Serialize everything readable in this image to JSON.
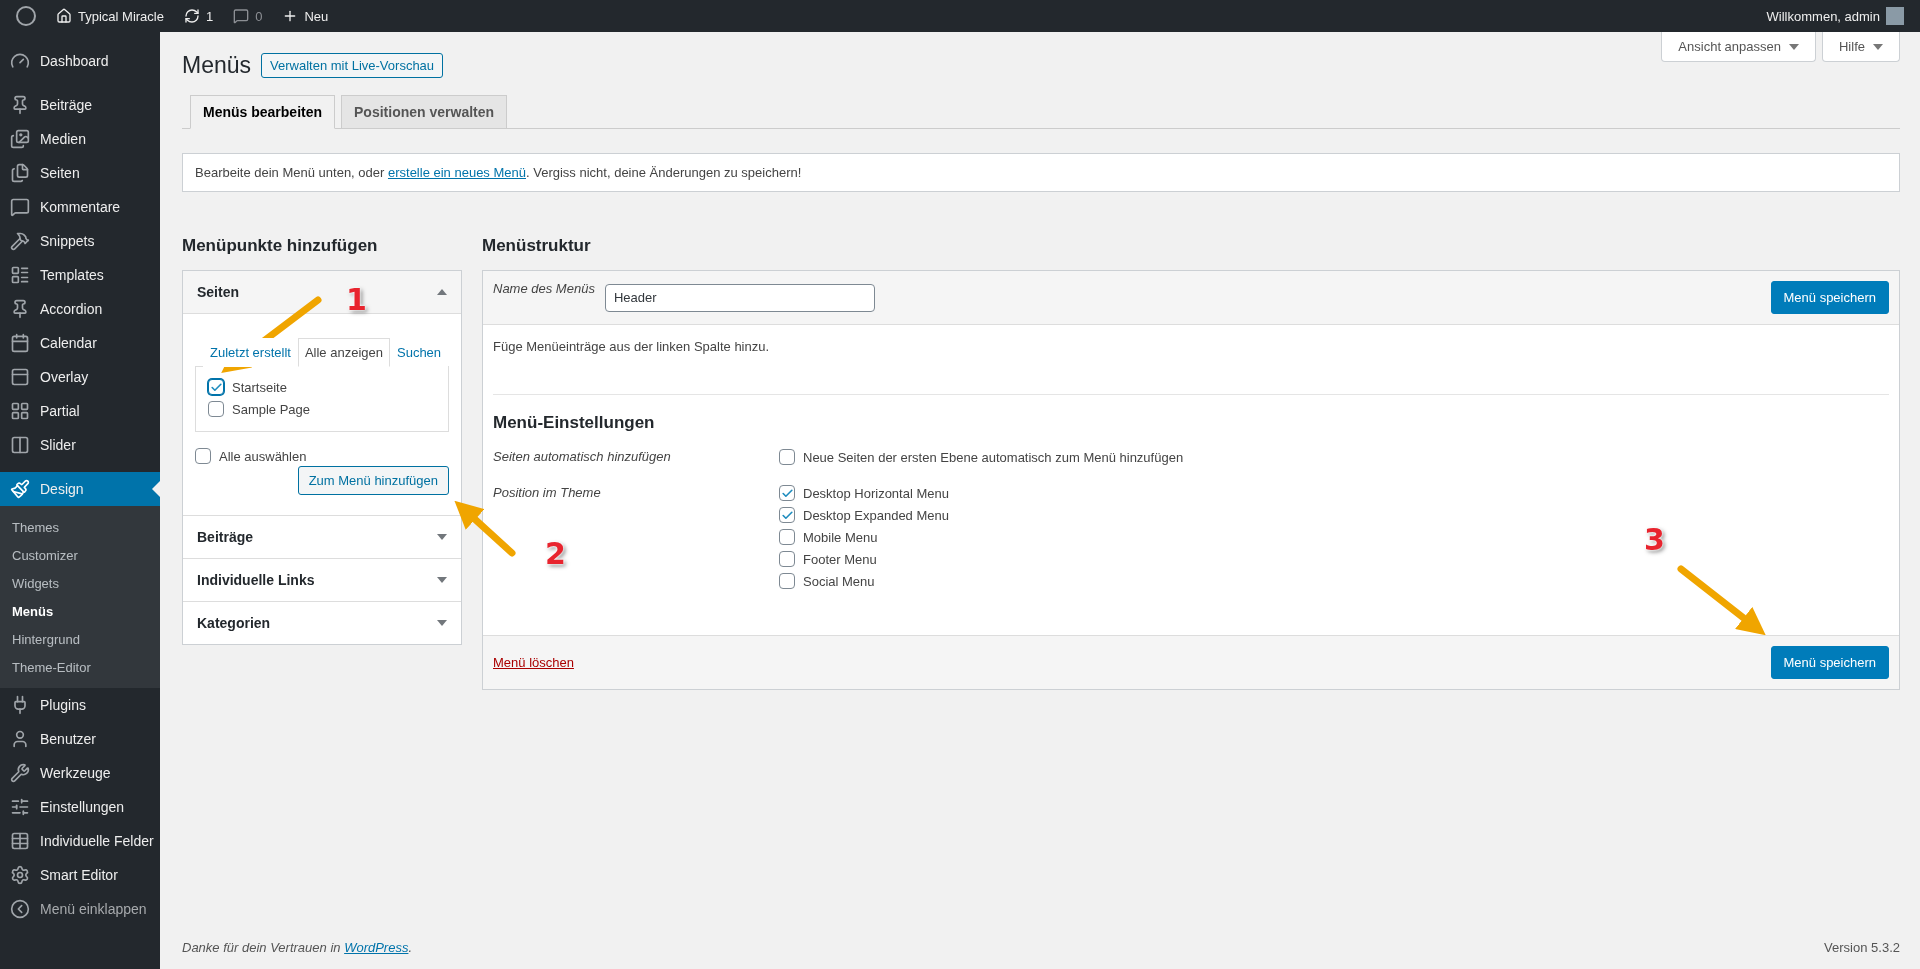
{
  "admin_bar": {
    "site": "Typical Miracle",
    "updates": "1",
    "comments": "0",
    "new": "Neu",
    "greeting": "Willkommen, admin"
  },
  "sidebar": {
    "items": [
      {
        "label": "Dashboard",
        "selected": false
      },
      {
        "label": "Beiträge",
        "selected": false
      },
      {
        "label": "Medien",
        "selected": false
      },
      {
        "label": "Seiten",
        "selected": false
      },
      {
        "label": "Kommentare",
        "selected": false
      },
      {
        "label": "Snippets",
        "selected": false
      },
      {
        "label": "Templates",
        "selected": false
      },
      {
        "label": "Accordion",
        "selected": false
      },
      {
        "label": "Calendar",
        "selected": false
      },
      {
        "label": "Overlay",
        "selected": false
      },
      {
        "label": "Partial",
        "selected": false
      },
      {
        "label": "Slider",
        "selected": false
      },
      {
        "label": "Design",
        "selected": true,
        "children": [
          {
            "label": "Themes",
            "selected": false
          },
          {
            "label": "Customizer",
            "selected": false
          },
          {
            "label": "Widgets",
            "selected": false
          },
          {
            "label": "Menüs",
            "selected": true
          },
          {
            "label": "Hintergrund",
            "selected": false
          },
          {
            "label": "Theme-Editor",
            "selected": false
          }
        ]
      },
      {
        "label": "Plugins",
        "selected": false
      },
      {
        "label": "Benutzer",
        "selected": false
      },
      {
        "label": "Werkzeuge",
        "selected": false
      },
      {
        "label": "Einstellungen",
        "selected": false
      },
      {
        "label": "Individuelle Felder",
        "selected": false
      },
      {
        "label": "Smart Editor",
        "selected": false
      },
      {
        "label": "Menü einklappen",
        "selected": false,
        "kind": "collapse"
      }
    ]
  },
  "screen_meta": [
    "Ansicht anpassen",
    "Hilfe"
  ],
  "page": {
    "title": "Menüs",
    "action": "Verwalten mit Live-Vorschau",
    "tabs": [
      {
        "label": "Menüs bearbeiten",
        "selected": true
      },
      {
        "label": "Positionen verwalten",
        "selected": false
      }
    ],
    "notice": {
      "before": "Bearbeite dein Menü unten, oder ",
      "link": "erstelle ein neues Menü",
      "after": ". Vergiss nicht, deine Änderungen zu speichern!"
    }
  },
  "add_items": {
    "heading": "Menüpunkte hinzufügen",
    "sections": [
      {
        "title": "Seiten",
        "expanded": true,
        "tabs": [
          {
            "label": "Zuletzt erstellt",
            "selected": false
          },
          {
            "label": "Alle anzeigen",
            "selected": true
          },
          {
            "label": "Suchen",
            "selected": false
          }
        ],
        "pages": [
          {
            "label": "Startseite",
            "checked": true
          },
          {
            "label": "Sample Page",
            "checked": false
          }
        ],
        "select_all": {
          "label": "Alle auswählen",
          "checked": false
        },
        "button": "Zum Menü hinzufügen"
      },
      {
        "title": "Beiträge",
        "expanded": false
      },
      {
        "title": "Individuelle Links",
        "expanded": false
      },
      {
        "title": "Kategorien",
        "expanded": false
      }
    ]
  },
  "structure": {
    "heading": "Menüstruktur",
    "name_label": "Name des Menüs",
    "name_value": "Header",
    "save": "Menü speichern",
    "hint": "Füge Menüeinträge aus der linken Spalte hinzu.",
    "settings_heading": "Menü-Einstellungen",
    "settings": [
      {
        "label": "Seiten automatisch hinzufügen",
        "options": [
          {
            "label": "Neue Seiten der ersten Ebene automatisch zum Menü hinzufügen",
            "checked": false
          }
        ]
      },
      {
        "label": "Position im Theme",
        "options": [
          {
            "label": "Desktop Horizontal Menu",
            "checked": true
          },
          {
            "label": "Desktop Expanded Menu",
            "checked": true
          },
          {
            "label": "Mobile Menu",
            "checked": false
          },
          {
            "label": "Footer Menu",
            "checked": false
          },
          {
            "label": "Social Menu",
            "checked": false
          }
        ]
      }
    ],
    "delete": "Menü löschen",
    "save_bottom": "Menü speichern"
  },
  "footer": {
    "before": "Danke für dein Vertrauen in ",
    "link": "WordPress",
    "after": ".",
    "version": "Version 5.3.2"
  },
  "annotations": [
    "1",
    "2",
    "3"
  ]
}
